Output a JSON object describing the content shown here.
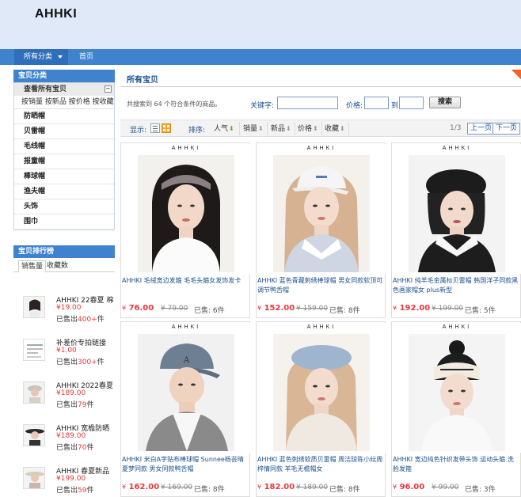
{
  "brand": "AHHKI",
  "nav": {
    "all_categories": "所有分类",
    "home": "首页"
  },
  "sidebar": {
    "category_title": "宝贝分类",
    "view_all": "查看所有宝贝",
    "sort_links": "按销量 按新品 按价格 按收藏",
    "categories": [
      "防晒帽",
      "贝雷帽",
      "毛线帽",
      "报童帽",
      "棒球帽",
      "渔夫帽",
      "头饰",
      "围巾"
    ],
    "ranking_title": "宝贝排行榜",
    "ranking_tabs": [
      "销售量",
      "收藏数"
    ],
    "ranking": [
      {
        "name": "AHHKI 22春夏 棉",
        "price": "¥19.00",
        "sold_prefix": "已售出",
        "sold_num": "400+",
        "sold_suffix": "件"
      },
      {
        "name": "补差价专拍链接",
        "price": "¥1.00",
        "sold_prefix": "已售出",
        "sold_num": "300+",
        "sold_suffix": "件"
      },
      {
        "name": "AHHKI 2022春夏",
        "price": "¥189.00",
        "sold_prefix": "已售出",
        "sold_num": "79",
        "sold_suffix": "件"
      },
      {
        "name": "AHHKI 宽檐防晒",
        "price": "¥189.00",
        "sold_prefix": "已售出",
        "sold_num": "70",
        "sold_suffix": "件"
      },
      {
        "name": "AHHKI 春夏新品",
        "price": "¥199.00",
        "sold_prefix": "已售出",
        "sold_num": "59",
        "sold_suffix": "件"
      }
    ]
  },
  "main": {
    "title": "所有宝贝",
    "search_info": "共搜索到 64 个符合条件的商品。",
    "keyword_label": "关键字:",
    "keyword_value": "",
    "price_label": "价格:",
    "price_to": "到",
    "price_min": "",
    "price_max": "",
    "search_button": "搜索",
    "display_label": "显示:",
    "sort_label": "排序:",
    "sort_options": [
      "人气",
      "销量",
      "新品",
      "价格",
      "收藏"
    ],
    "pager": "1/3",
    "prev_page": "上一页",
    "next_page": "下一页"
  },
  "products": [
    {
      "brand_mark": "AHHKI",
      "title": "AHHKI 毛绒宽边发箍 毛毛头箍女发饰发卡",
      "price": "76.00",
      "orig": "¥ 79.00",
      "sold": "已售: 6件"
    },
    {
      "brand_mark": "AHHKI",
      "title": "AHHKI 蓝色青藏刺绣棒球帽 男女同款软顶可调节鸭舌帽",
      "price": "152.00",
      "orig": "¥ 159.00",
      "sold": "已售: 8件"
    },
    {
      "brand_mark": "AHHKI",
      "title": "AHHKI 纯羊毛金属标贝雷帽 韩国洋子同款黑色画家帽女 plus新型",
      "price": "192.00",
      "orig": "¥ 199.00",
      "sold": "已售: 5件"
    },
    {
      "brand_mark": "AHHKI",
      "title": "AHHKI 米白A字贴布棒球帽 Sunnee杨芸晴夏梦同款 男女同款鸭舌帽",
      "price": "162.00",
      "orig": "¥ 169.00",
      "sold": "已售: 8件"
    },
    {
      "brand_mark": "AHHKI",
      "title": "AHHKI 蓝色刺绣软质贝雷帽 周洁琼陈小纭周梓情同款 羊毛无檐帽女",
      "price": "182.00",
      "orig": "¥ 189.00",
      "sold": "已售: 8件"
    },
    {
      "brand_mark": "AHHKI",
      "title": "AHHKI 宽边纯色针织发带头饰 运动头箍 洗脸发箍",
      "price": "96.00",
      "orig": "¥ 99.00",
      "sold": "已售: 3件"
    }
  ],
  "currency_symbol": "¥",
  "colors": {
    "nav_blue": "#3f83cf",
    "header_bg": "#dfe9f7",
    "price_red": "#e4393c",
    "link_blue": "#1a4f8f"
  }
}
